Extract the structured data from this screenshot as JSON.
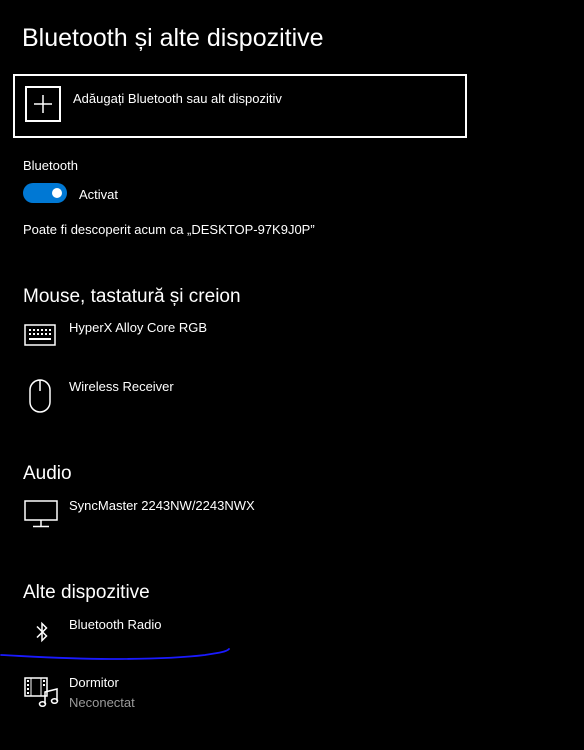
{
  "page": {
    "title": "Bluetooth și alte dispozitive"
  },
  "add_device": {
    "label": "Adăugați Bluetooth sau alt dispozitiv",
    "icon": "plus-icon"
  },
  "bluetooth": {
    "label": "Bluetooth",
    "toggle_state": "Activat",
    "toggle_on": true,
    "accent_color": "#0078d4",
    "discoverable_text": "Poate fi descoperit acum ca „DESKTOP-97K9J0P”"
  },
  "sections": {
    "mouse": {
      "title": "Mouse, tastatură și creion",
      "devices": [
        {
          "name": "HyperX Alloy Core RGB",
          "icon": "keyboard-icon"
        },
        {
          "name": "Wireless Receiver",
          "icon": "mouse-icon"
        }
      ]
    },
    "audio": {
      "title": "Audio",
      "devices": [
        {
          "name": "SyncMaster 2243NW/2243NWX",
          "icon": "monitor-icon"
        }
      ]
    },
    "other": {
      "title": "Alte dispozitive",
      "devices": [
        {
          "name": "Bluetooth Radio",
          "icon": "bluetooth-icon"
        },
        {
          "name": "Dormitor",
          "status": "Neconectat",
          "icon": "media-device-icon"
        }
      ]
    }
  },
  "annotation": {
    "color": "#1a1aff"
  }
}
